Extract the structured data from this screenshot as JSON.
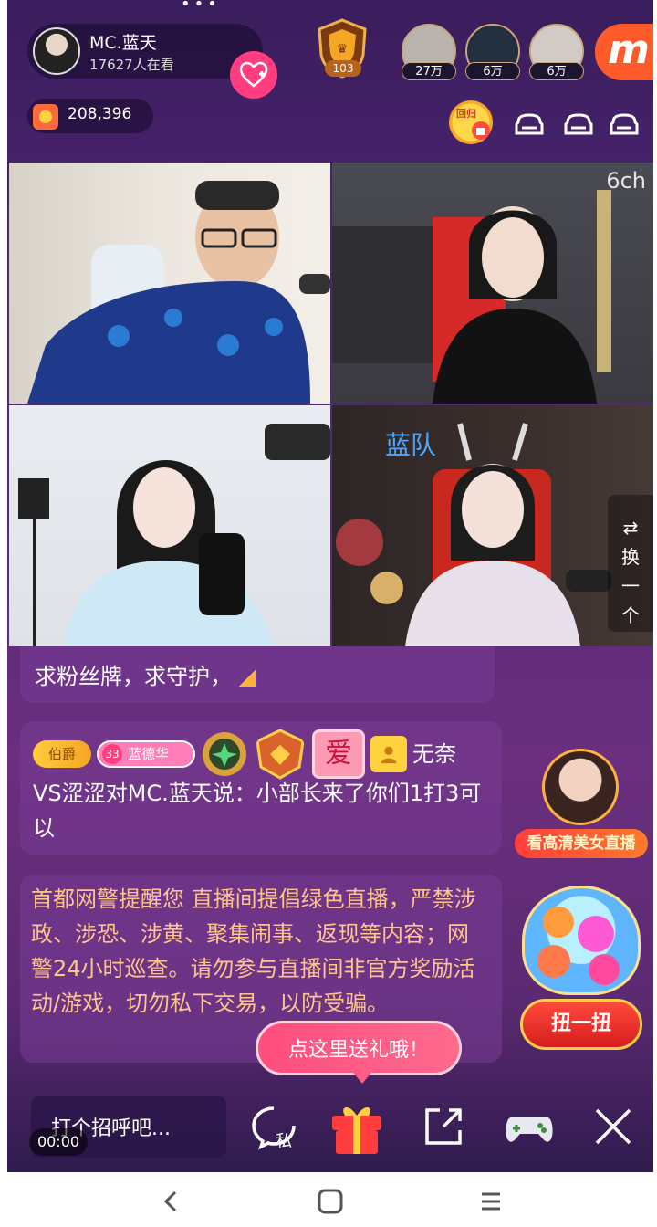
{
  "host": {
    "name": "MC.蓝天",
    "viewers": "17627人在看"
  },
  "rank_badge": {
    "level": "103"
  },
  "viewer_avatars": [
    {
      "count": "27万",
      "color": "#b9b4ad"
    },
    {
      "count": "6万",
      "color": "#223040"
    },
    {
      "count": "6万",
      "color": "#d0cbc6"
    }
  ],
  "brand_logo": "m",
  "coins": {
    "value": "208,396"
  },
  "guard_badge": {
    "label": "回归"
  },
  "video": {
    "team_label": "蓝队",
    "switch_label": [
      "换",
      "一",
      "个"
    ],
    "watermark": "6ch"
  },
  "chat": {
    "message_partial": "求粉丝牌，求守护，",
    "badges": {
      "title": "伯爵",
      "fan_level": "33",
      "fan_name": "蓝德华",
      "love": "爱"
    },
    "message_user": "无奈",
    "message_text": "VS涩涩对MC.蓝天说：小部长来了你们1打3可以",
    "notice": "首都网警提醒您 直播间提倡绿色直播，严禁涉政、涉恐、涉黄、聚集闹事、返现等内容；网警24小时巡查。请勿参与直播间非官方奖励活动/游戏，切勿私下交易，以防受骗。"
  },
  "promo": {
    "live_tag": "看高清美女直播",
    "gacha_button": "扭一扭"
  },
  "gift_tip": "点这里送礼哦！",
  "bottom_bar": {
    "input_placeholder": "打个招呼吧...",
    "timer": "00:00",
    "private_label": "私"
  },
  "colors": {
    "accent_pink": "#ff3d7f",
    "team_blue": "#4aa8ff",
    "notice_orange": "#ffc58a"
  }
}
